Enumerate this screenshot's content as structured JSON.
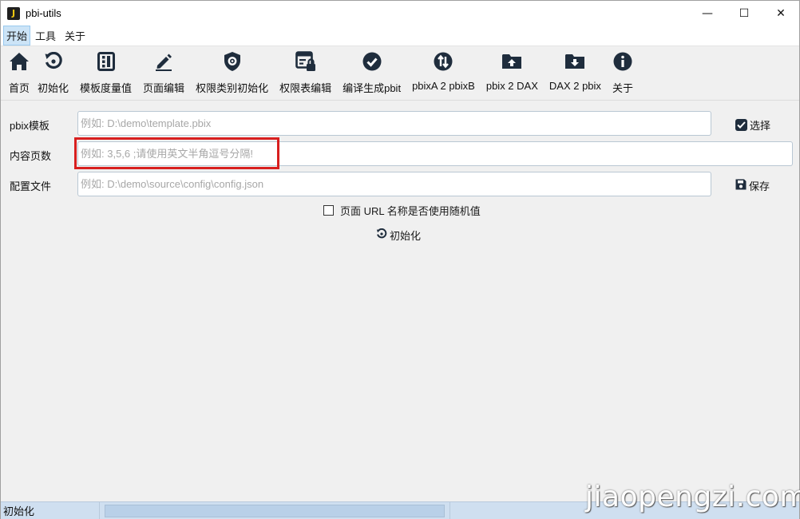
{
  "window": {
    "title": "pbi-utils",
    "app_icon_letter": "J",
    "controls": {
      "minimize": "—",
      "maximize": "☐",
      "close": "✕"
    }
  },
  "menu": [
    "开始",
    "工具",
    "关于"
  ],
  "toolbar": [
    {
      "label": "首页",
      "icon": "home-icon"
    },
    {
      "label": "初始化",
      "icon": "refresh-icon"
    },
    {
      "label": "模板度量值",
      "icon": "template-measure-icon"
    },
    {
      "label": "页面编辑",
      "icon": "pencil-icon"
    },
    {
      "label": "权限类别初始化",
      "icon": "shield-gear-icon"
    },
    {
      "label": "权限表编辑",
      "icon": "table-lock-icon"
    },
    {
      "label": "编译生成pbit",
      "icon": "check-circle-icon"
    },
    {
      "label": "pbixA 2 pbixB",
      "icon": "transfer-icon"
    },
    {
      "label": "pbix 2 DAX",
      "icon": "folder-upload-icon"
    },
    {
      "label": "DAX 2 pbix",
      "icon": "folder-download-icon"
    },
    {
      "label": "关于",
      "icon": "info-icon"
    }
  ],
  "form": {
    "template": {
      "label": "pbix模板",
      "placeholder": "例如: D:\\demo\\template.pbix",
      "button": "选择"
    },
    "pages": {
      "label": "内容页数",
      "placeholder": "例如: 3,5,6 ;请使用英文半角逗号分隔!"
    },
    "config": {
      "label": "配置文件",
      "placeholder": "例如: D:\\demo\\source\\config\\config.json",
      "button": "保存"
    },
    "random_url": {
      "label": "页面 URL 名称是否使用随机值",
      "checked": false
    },
    "init_button": "初始化"
  },
  "status": {
    "text": "初始化"
  },
  "watermark": "jiaopengzi.com",
  "colors": {
    "icon": "#1f2d3d",
    "highlight": "#d81f1f",
    "status_bg": "#cfdff0"
  }
}
